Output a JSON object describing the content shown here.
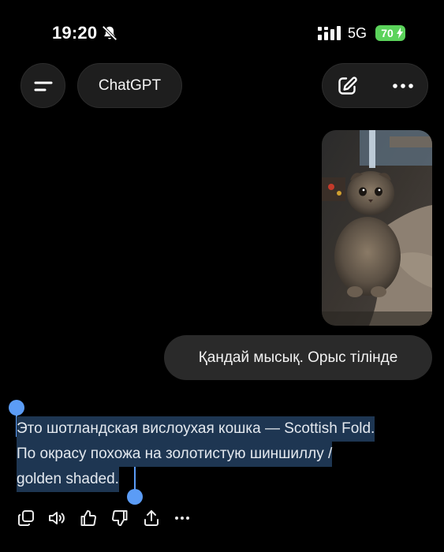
{
  "status_bar": {
    "time": "19:20",
    "network": "5G",
    "battery": "70"
  },
  "header": {
    "model_label": "ChatGPT"
  },
  "conversation": {
    "user_message": "Қандай мысық. Орыс тілінде",
    "assistant_reply_lines": [
      "Это шотландская вислоухая кошка — Scottish Fold.",
      "По окрасу похожа на золотистую шиншиллу /",
      "golden shaded."
    ]
  },
  "icons": {
    "status": [
      "bell-slash-icon",
      "cellular-signal-icon",
      "battery-charging-icon"
    ],
    "header": [
      "menu-icon",
      "new-chat-icon",
      "more-icon"
    ],
    "reply_actions": [
      "copy-icon",
      "read-aloud-icon",
      "thumbs-up-icon",
      "thumbs-down-icon",
      "share-icon",
      "more-icon"
    ]
  },
  "colors": {
    "background": "#000000",
    "pill": "#1e1e1e",
    "user_bubble": "#2a2a2a",
    "selection": "#1e3652",
    "selection_handle": "#5b9cf6",
    "battery": "#5bd35b"
  }
}
